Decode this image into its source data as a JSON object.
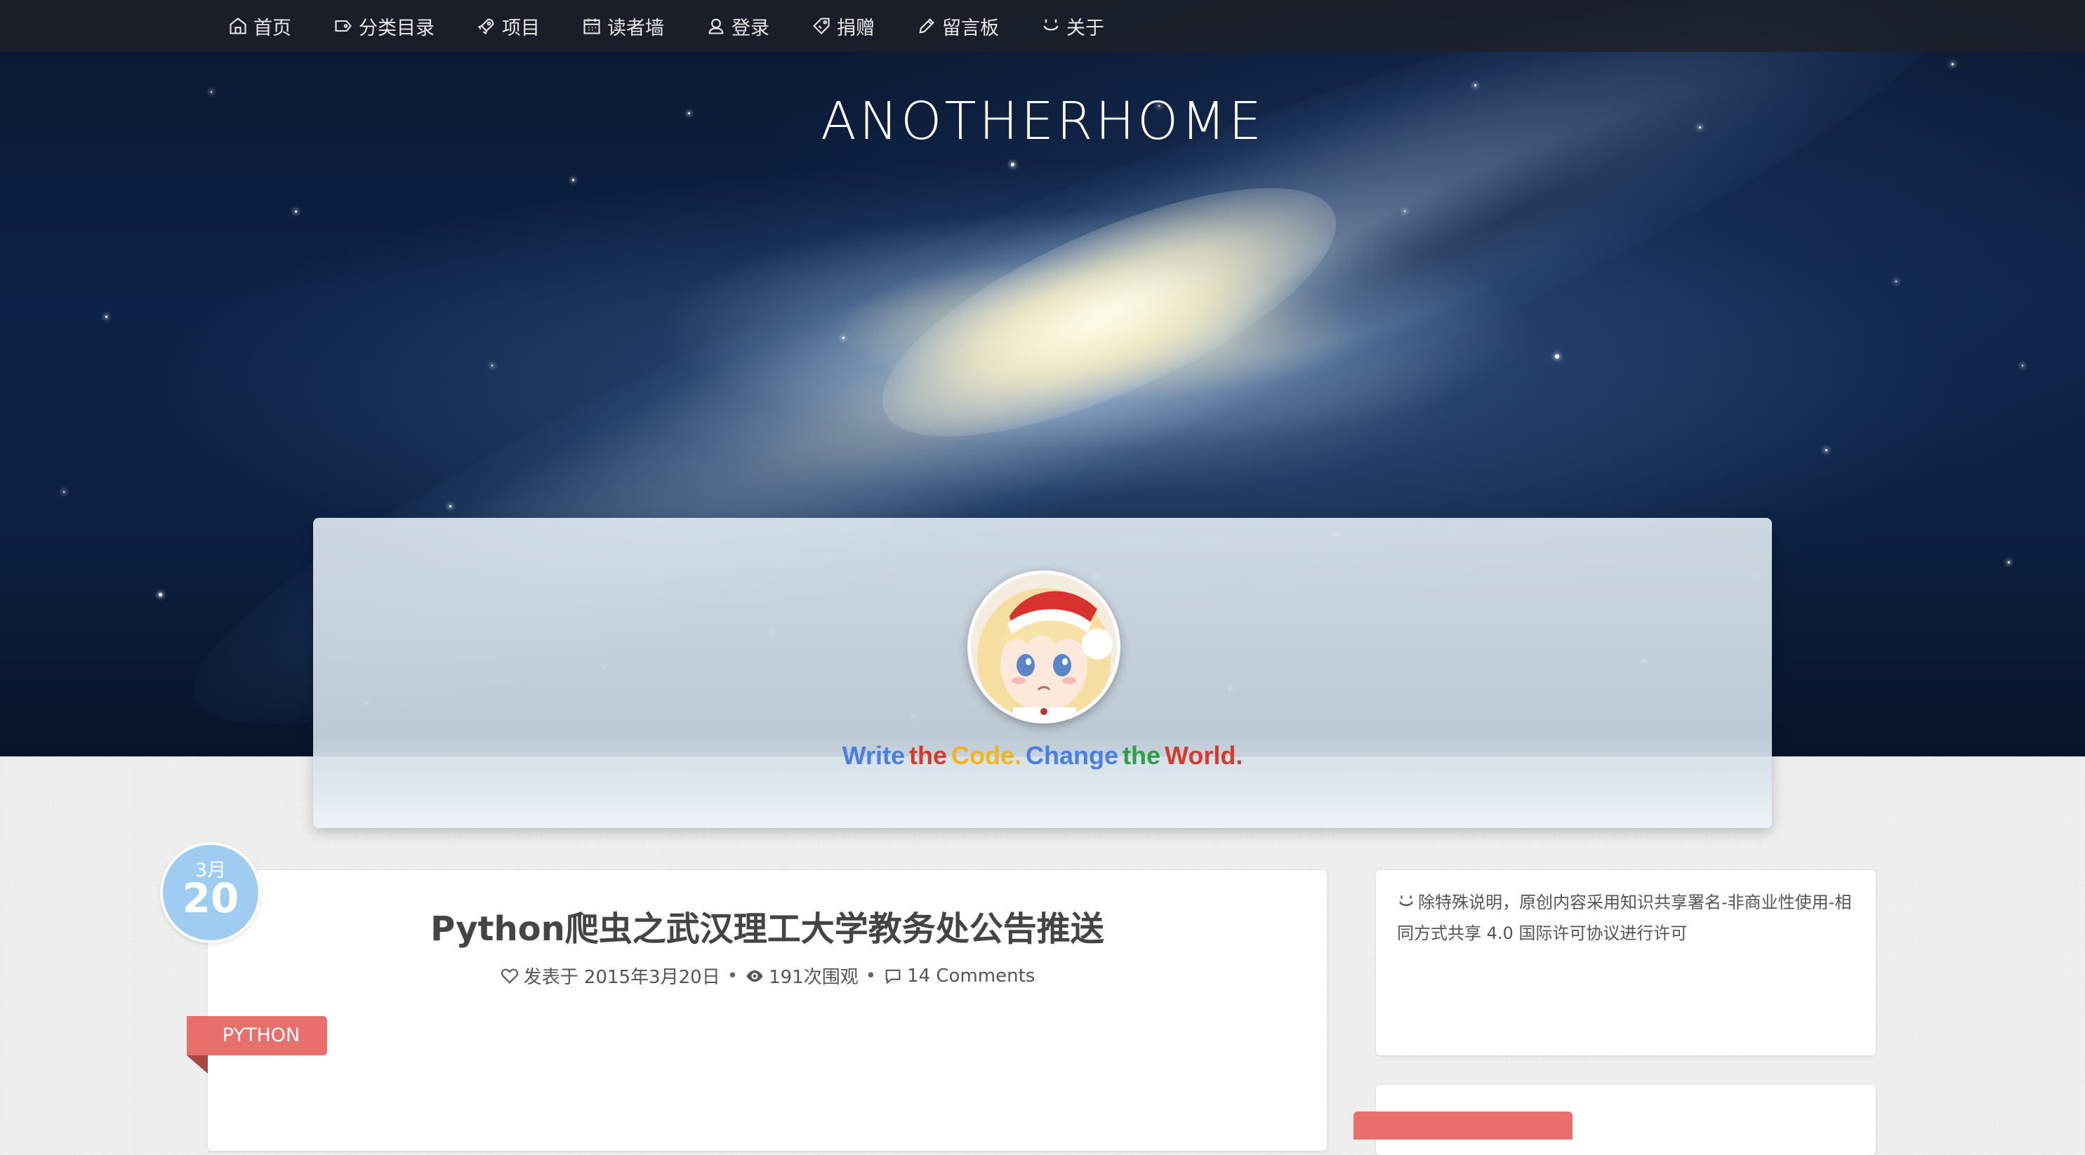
{
  "nav": {
    "items": [
      {
        "label": "首页",
        "icon": "home-icon"
      },
      {
        "label": "分类目录",
        "icon": "tag-icon"
      },
      {
        "label": "项目",
        "icon": "rocket-icon"
      },
      {
        "label": "读者墙",
        "icon": "calendar-icon"
      },
      {
        "label": "登录",
        "icon": "user-icon"
      },
      {
        "label": "捐赠",
        "icon": "price-tag-icon"
      },
      {
        "label": "留言板",
        "icon": "pencil-icon"
      },
      {
        "label": "关于",
        "icon": "smiley-icon"
      }
    ]
  },
  "site": {
    "title": "ANOTHERHOME"
  },
  "profile": {
    "avatar_icon": "avatar-anime-girl-icon",
    "slogan": [
      {
        "text": "Write",
        "color": "#4a7fe0"
      },
      {
        "text": "the",
        "color": "#d33b2c"
      },
      {
        "text": "Code.",
        "color": "#f2b51c"
      },
      {
        "text": "Change",
        "color": "#4a7fe0"
      },
      {
        "text": "the",
        "color": "#2f9c46"
      },
      {
        "text": "World.",
        "color": "#d33b2c"
      }
    ]
  },
  "post": {
    "date_month": "3月",
    "date_day": "20",
    "title": "Python爬虫之武汉理工大学教务处公告推送",
    "meta": {
      "posted": "发表于 2015年3月20日",
      "views": "191次围观",
      "comments": "14 Comments"
    },
    "category": "PYTHON"
  },
  "sidebar": {
    "license_text": "除特殊说明，原创内容采用知识共享署名-非商业性使用-相同方式共享 4.0 国际许可协议进行许可"
  },
  "colors": {
    "nav_bg": "#1e2026",
    "accent_red": "#e96f6c",
    "date_badge": "#9fcdf1",
    "text_dark": "#444444"
  }
}
